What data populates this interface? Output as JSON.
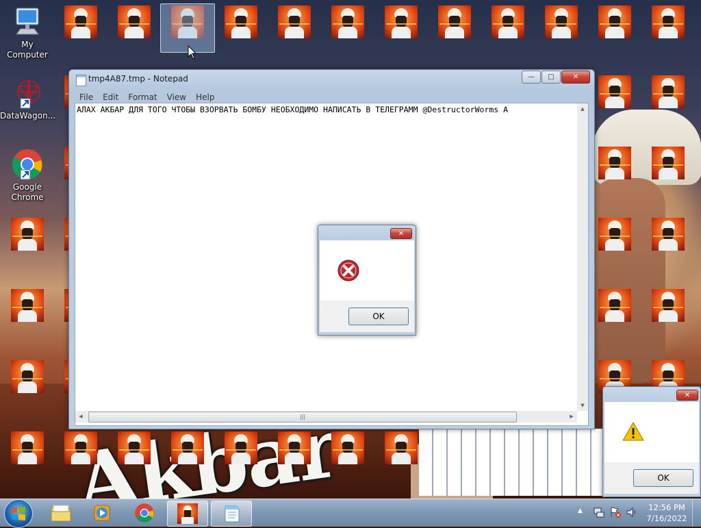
{
  "desktop": {
    "icons": [
      {
        "label": "My Computer"
      },
      {
        "label": "DataWagon..."
      },
      {
        "label": "Google Chrome"
      }
    ],
    "wallpaper_text": "Akbar"
  },
  "notepad": {
    "title": "tmp4A87.tmp - Notepad",
    "menu": [
      "File",
      "Edit",
      "Format",
      "View",
      "Help"
    ],
    "content": "АЛАХ АКБАР ДЛЯ ТОГО ЧТОБЫ ВЗОРВАТЬ БОМБУ НЕОБХОДИМО НАПИСАТЬ В ТЕЛЕГРАММ @DestructorWorms А",
    "scroll_grip": "|||",
    "buttons": {
      "minimize": "—",
      "maximize": "□",
      "close": "✕"
    }
  },
  "error_dialog": {
    "title": "",
    "message": "",
    "ok_label": "OK",
    "icon": "error-icon"
  },
  "warning_dialog": {
    "title": "",
    "message": "",
    "ok_label": "OK",
    "icon": "warning-icon"
  },
  "taskbar": {
    "start": "start-orb",
    "pinned": [
      "explorer-icon",
      "media-player-icon",
      "chrome-icon",
      "wallpaper-app-icon",
      "notepad-icon"
    ],
    "tray": {
      "time": "12:56 PM",
      "date": "7/16/2022"
    }
  },
  "colors": {
    "accent_close": "#c8453a",
    "error_red": "#c0262c",
    "warning_yellow": "#f4c400",
    "taskbar": "#7f98b3"
  }
}
